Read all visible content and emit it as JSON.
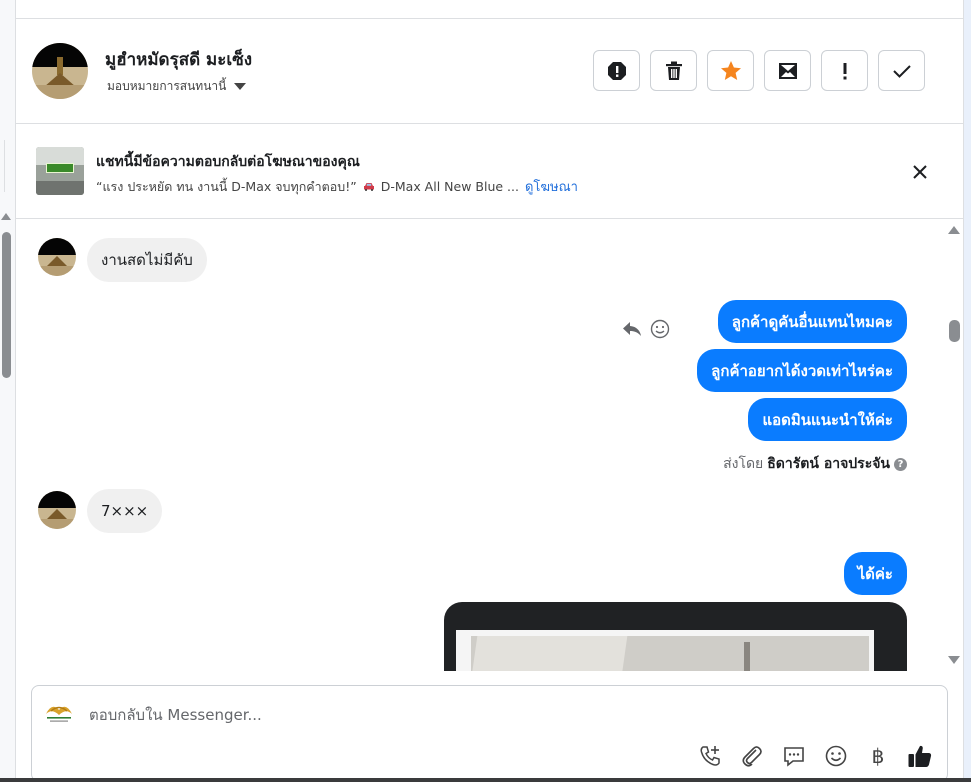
{
  "header": {
    "contact_name": "มูฮำหมัดรุสดี มะเซ็ง",
    "assign_label": "มอบหมายการสนทนานี้",
    "actions": [
      {
        "name": "report-spam-button",
        "icon": "alert-octagon-icon"
      },
      {
        "name": "delete-button",
        "icon": "trash-icon"
      },
      {
        "name": "star-button",
        "icon": "star-icon"
      },
      {
        "name": "mark-unread-button",
        "icon": "envelope-icon"
      },
      {
        "name": "follow-up-button",
        "icon": "exclamation-icon"
      },
      {
        "name": "mark-done-button",
        "icon": "check-icon"
      }
    ],
    "star_color": "#f5851f"
  },
  "banner": {
    "title": "แชทนี้มีข้อความตอบกลับต่อโฆษณาของคุณ",
    "quote": "“แรง ประหยัด ทน งานนี้ D-Max จบทุกคำตอบ!”",
    "ad_name": "D-Max All New Blue ...",
    "link": "ดูโฆษณา"
  },
  "messages": {
    "incoming_1": "งานสดไม่มีคับ",
    "outgoing_1": "ลูกค้าดูคันอื่นแทนไหมคะ",
    "outgoing_2": "ลูกค้าอยากได้งวดเท่าไหร่คะ",
    "outgoing_3": "แอดมินแนะนำให้ค่ะ",
    "sent_by_prefix": "ส่งโดย",
    "sent_by_name": "ธิดารัตน์ อาจประจัน",
    "incoming_2": "7×××",
    "outgoing_4": "ได้ค่ะ",
    "bubble_color": "#0a7cff"
  },
  "composer": {
    "placeholder": "ตอบกลับใน Messenger...",
    "tools": [
      "call-add-icon",
      "paperclip-icon",
      "chat-bubble-icon",
      "smiley-icon",
      "baht-icon",
      "thumbs-up-icon"
    ],
    "baht_symbol": "฿"
  }
}
